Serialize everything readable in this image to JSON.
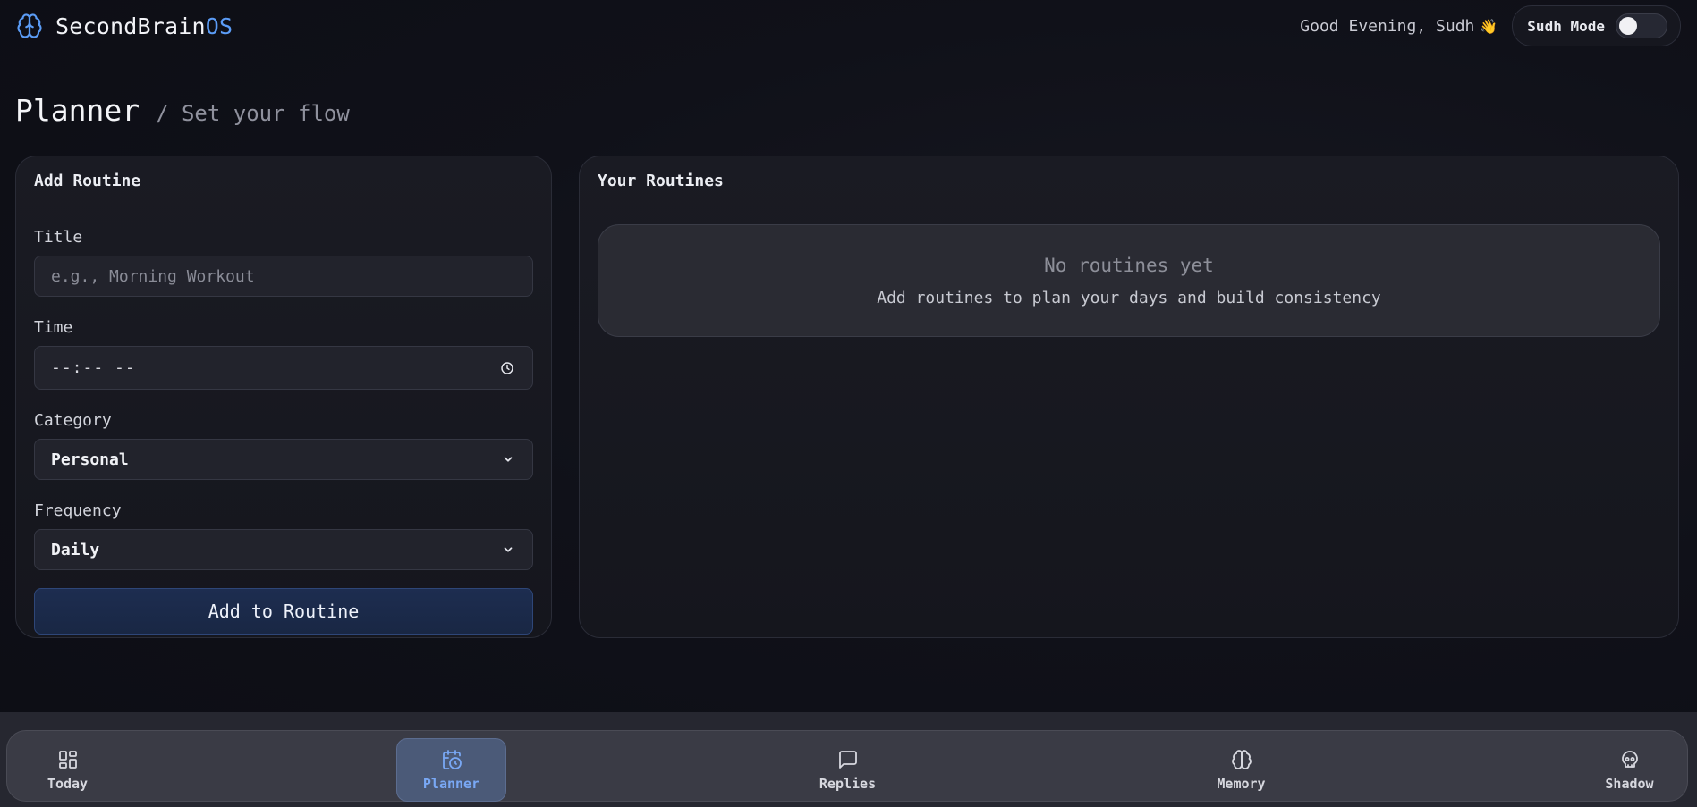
{
  "app": {
    "name_main": "SecondBrain",
    "name_accent": "OS",
    "logo_icon": "brain-icon",
    "accent_color": "#5b9cf6"
  },
  "header": {
    "greeting": "Good Evening, Sudh",
    "greeting_emoji": "👋",
    "mode_label": "Sudh Mode",
    "mode_on": false
  },
  "page": {
    "title": "Planner",
    "subtitle": "/ Set your flow"
  },
  "add_routine": {
    "heading": "Add Routine",
    "title_label": "Title",
    "title_placeholder": "e.g., Morning Workout",
    "time_label": "Time",
    "time_value": "--:-- --",
    "time_icon": "clock-icon",
    "category_label": "Category",
    "category_value": "Personal",
    "frequency_label": "Frequency",
    "frequency_value": "Daily",
    "submit_label": "Add to Routine"
  },
  "routines": {
    "heading": "Your Routines",
    "empty_title": "No routines yet",
    "empty_message": "Add routines to plan your days and build consistency"
  },
  "nav": {
    "items": [
      {
        "label": "Today",
        "icon": "grid-icon",
        "active": false
      },
      {
        "label": "Planner",
        "icon": "calendar-clock-icon",
        "active": true
      },
      {
        "label": "Replies",
        "icon": "message-square-icon",
        "active": false
      },
      {
        "label": "Memory",
        "icon": "brain-icon",
        "active": false
      },
      {
        "label": "Shadow",
        "icon": "skull-icon",
        "active": false
      }
    ]
  }
}
